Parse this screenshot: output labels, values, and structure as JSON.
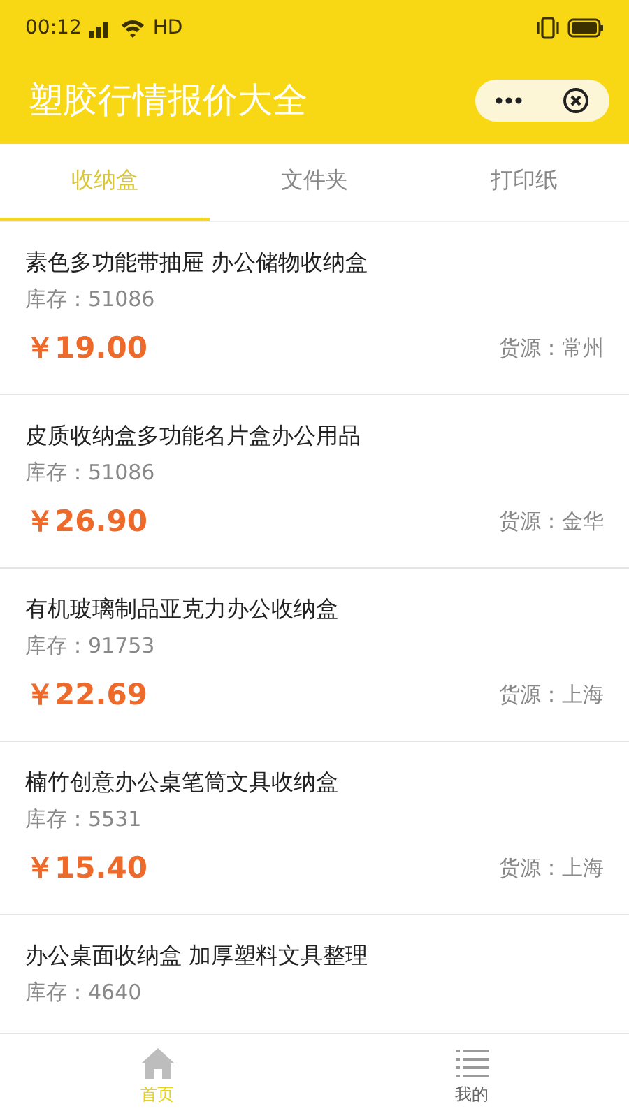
{
  "status_bar": {
    "time": "00:12",
    "network": "HD"
  },
  "header": {
    "title": "塑胶行情报价大全"
  },
  "tabs": [
    {
      "label": "收纳盒",
      "selected": true
    },
    {
      "label": "文件夹",
      "selected": false
    },
    {
      "label": "打印纸",
      "selected": false
    }
  ],
  "products": [
    {
      "name": "素色多功能带抽屉 办公储物收纳盒",
      "stock": "库存：51086",
      "price": "￥19.00",
      "origin": "货源：常州"
    },
    {
      "name": "皮质收纳盒多功能名片盒办公用品",
      "stock": "库存：51086",
      "price": "￥26.90",
      "origin": "货源：金华"
    },
    {
      "name": "有机玻璃制品亚克力办公收纳盒",
      "stock": "库存：91753",
      "price": "￥22.69",
      "origin": "货源：上海"
    },
    {
      "name": "楠竹创意办公桌笔筒文具收纳盒",
      "stock": "库存：5531",
      "price": "￥15.40",
      "origin": "货源：上海"
    },
    {
      "name": "办公桌面收纳盒 加厚塑料文具整理",
      "stock": "库存：4640"
    }
  ],
  "bottom_nav": [
    {
      "label": "首页",
      "kind": "home",
      "selected": true
    },
    {
      "label": "我的",
      "kind": "list",
      "selected": false
    }
  ]
}
